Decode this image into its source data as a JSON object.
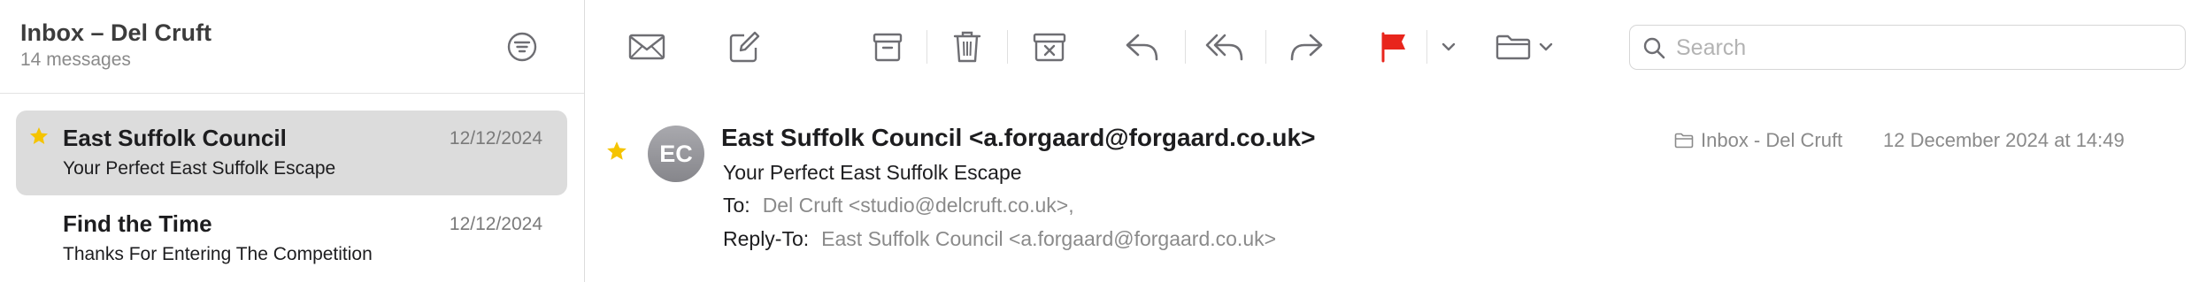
{
  "sidebar": {
    "title": "Inbox – Del Cruft",
    "count": "14 messages",
    "filter_icon": "filter-icon",
    "messages": [
      {
        "sender": "East Suffolk Council",
        "date": "12/12/2024",
        "subject": "Your Perfect East Suffolk Escape",
        "starred": true,
        "selected": true
      },
      {
        "sender": "Find the Time",
        "date": "12/12/2024",
        "subject": "Thanks For Entering The Competition",
        "starred": false,
        "selected": false
      }
    ]
  },
  "toolbar": {
    "icons": [
      "envelope-icon",
      "compose-icon",
      "archive-icon",
      "trash-icon",
      "junk-icon",
      "reply-icon",
      "reply-all-icon",
      "forward-icon",
      "flag-icon",
      "chevron-down-icon",
      "folder-icon"
    ],
    "flag_color": "#e8251c",
    "search_placeholder": "Search"
  },
  "message": {
    "avatar_initials": "EC",
    "from": "East Suffolk Council <a.forgaard@forgaard.co.uk>",
    "subject": "Your Perfect East Suffolk Escape",
    "to_label": "To:",
    "to_value": "Del Cruft <studio@delcruft.co.uk>,",
    "reply_to_label": "Reply-To:",
    "reply_to_value": "East Suffolk Council <a.forgaard@forgaard.co.uk>",
    "mailbox": "Inbox - Del Cruft",
    "timestamp": "12 December 2024 at 14:49",
    "starred": true
  },
  "colors": {
    "star": "#f5c400",
    "selection": "#dcdcdc",
    "icon_gray": "#6e6e73"
  }
}
